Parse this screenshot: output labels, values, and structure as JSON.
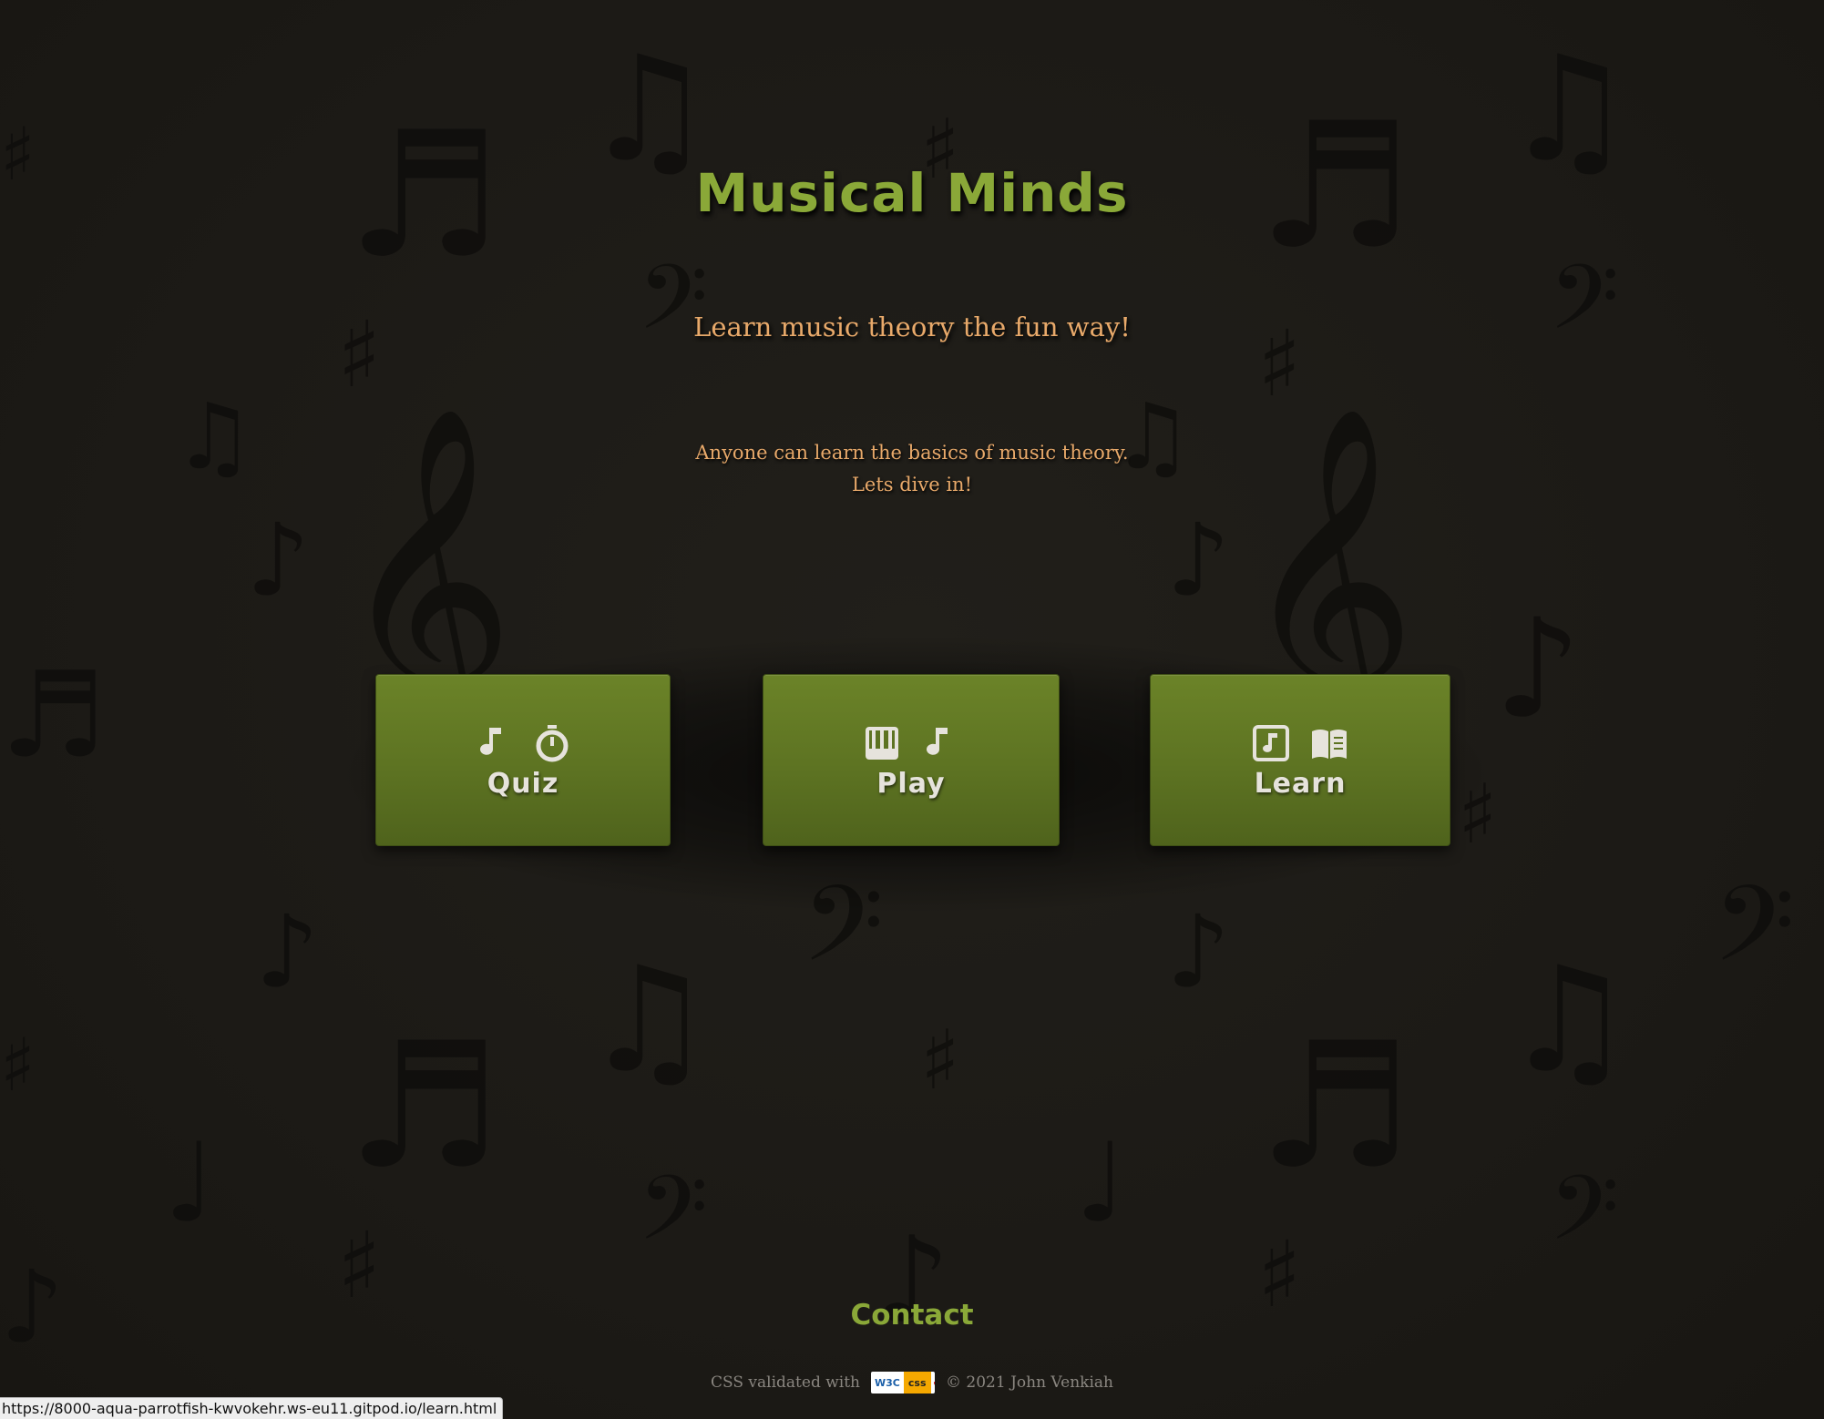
{
  "header": {
    "title": "Musical Minds",
    "tagline": "Learn music theory the fun way!"
  },
  "intro": {
    "line1": "Anyone can learn the basics of music theory.",
    "line2": "Lets dive in!"
  },
  "cards": [
    {
      "label": "Quiz",
      "icons": [
        "music-note-icon",
        "stopwatch-icon"
      ]
    },
    {
      "label": "Play",
      "icons": [
        "piano-icon",
        "music-note-icon"
      ]
    },
    {
      "label": "Learn",
      "icons": [
        "music-file-icon",
        "book-icon"
      ]
    }
  ],
  "footer": {
    "contact": "Contact",
    "validated_text": "CSS validated with",
    "badge_w3c": "W3C",
    "badge_css": "css",
    "copyright": "© 2021 John Venkiah"
  },
  "status_bar": {
    "url": "https://8000-aqua-parrotfish-kwvokehr.ws-eu11.gitpod.io/learn.html"
  },
  "colors": {
    "background": "#1d1b17",
    "title_green": "#8aa838",
    "text_orange": "#e8a96a",
    "card_green": "#5d7322",
    "card_text": "#e6e3dc"
  }
}
